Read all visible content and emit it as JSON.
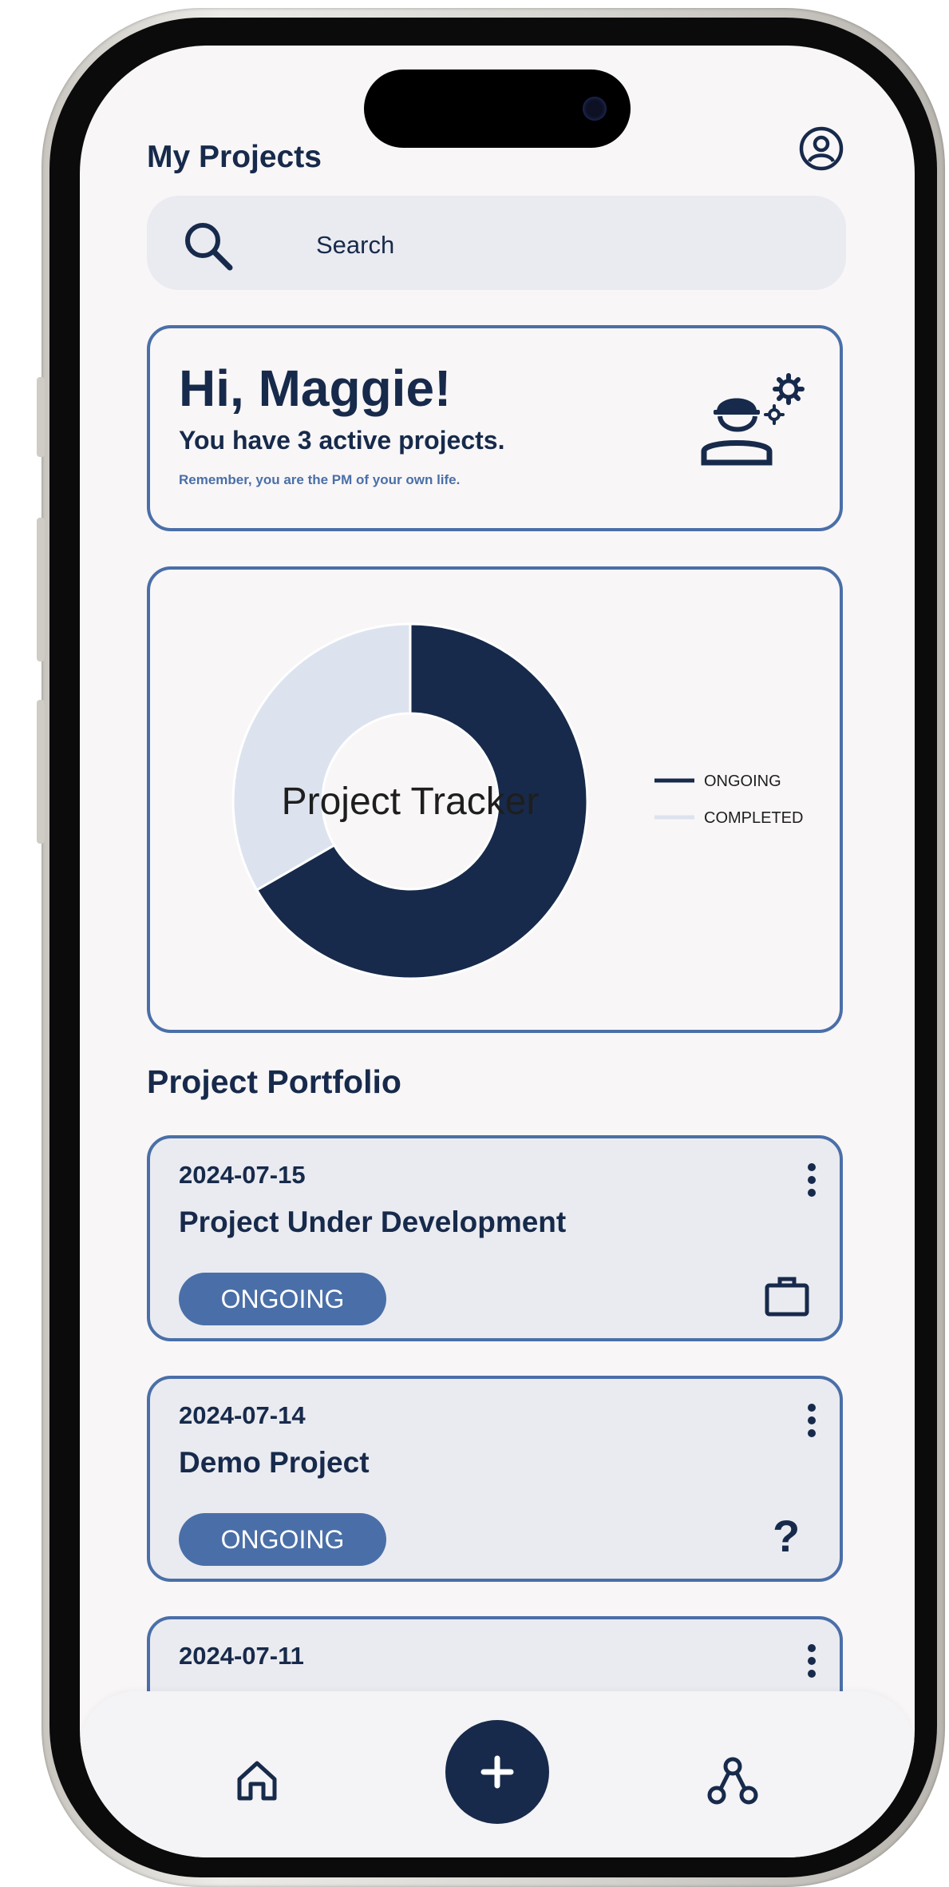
{
  "header": {
    "title": "My Projects"
  },
  "search": {
    "placeholder": "Search"
  },
  "greeting": {
    "title": "Hi, Maggie!",
    "subtitle": "You have 3 active projects.",
    "note": "Remember, you are the PM of your own life."
  },
  "chart_data": {
    "type": "pie",
    "title": "Project Tracker",
    "categories": [
      "ONGOING",
      "COMPLETED"
    ],
    "values": [
      2,
      1
    ],
    "colors": [
      "#172a4b",
      "#dde3ee"
    ],
    "legend_position": "right"
  },
  "portfolio": {
    "title": "Project Portfolio",
    "projects": [
      {
        "date": "2024-07-15",
        "name": "Project Under Development",
        "status": "ONGOING",
        "icon": "briefcase-icon"
      },
      {
        "date": "2024-07-14",
        "name": "Demo Project",
        "status": "ONGOING",
        "icon": "question-mark-icon",
        "icon_glyph": "?"
      },
      {
        "date": "2024-07-11"
      }
    ]
  },
  "nav": {
    "items": [
      "home-icon",
      "add-button",
      "workflow-icon"
    ]
  },
  "colors": {
    "navy": "#172a4b",
    "accent": "#4a6fa8",
    "card_bg": "#eaebf0",
    "screen_bg": "#f8f6f7"
  }
}
